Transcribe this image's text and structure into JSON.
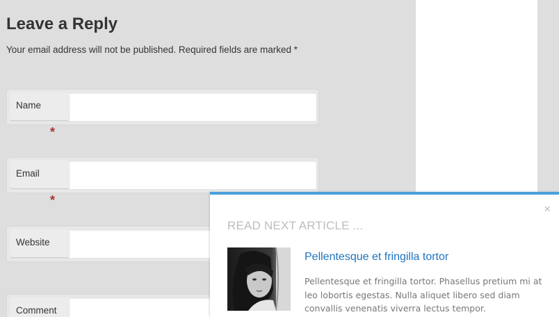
{
  "comments": {
    "title": "Leave a Reply",
    "notice": "Your email address will not be published. Required fields are marked *",
    "required_mark": "*",
    "fields": [
      {
        "label": "Name",
        "value": ""
      },
      {
        "label": "Email",
        "value": ""
      },
      {
        "label": "Website",
        "value": ""
      },
      {
        "label": "Comment",
        "value": ""
      }
    ]
  },
  "popup": {
    "close_glyph": "×",
    "heading": "READ NEXT ARTICLE ...",
    "article": {
      "title": "Pellentesque et fringilla tortor",
      "excerpt": "Pellentesque et fringilla tortor. Phasellus pretium mi at leo lobortis egestas. Nulla aliquet libero sed diam convallis venenatis viverra lectus tempor."
    },
    "accent_color": "#4a9fdc",
    "link_color": "#1e73be"
  }
}
